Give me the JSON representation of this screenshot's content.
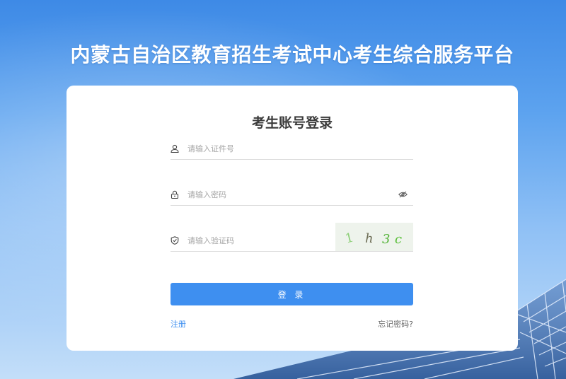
{
  "page": {
    "title": "内蒙古自治区教育招生考试中心考生综合服务平台"
  },
  "login": {
    "heading": "考生账号登录",
    "id_placeholder": "请输入证件号",
    "password_placeholder": "请输入密码",
    "captcha_placeholder": "请输入验证码",
    "captcha_text": "1 h 3 c",
    "submit_label": "登 录",
    "register_label": "注册",
    "forgot_label": "忘记密码?"
  },
  "colors": {
    "accent": "#3e8ff0",
    "card_bg": "#ffffff",
    "captcha_green": "#5bbf3a"
  },
  "icons": {
    "id": "user-icon",
    "password": "lock-icon",
    "captcha": "shield-icon",
    "toggle": "eye-hidden-icon"
  }
}
